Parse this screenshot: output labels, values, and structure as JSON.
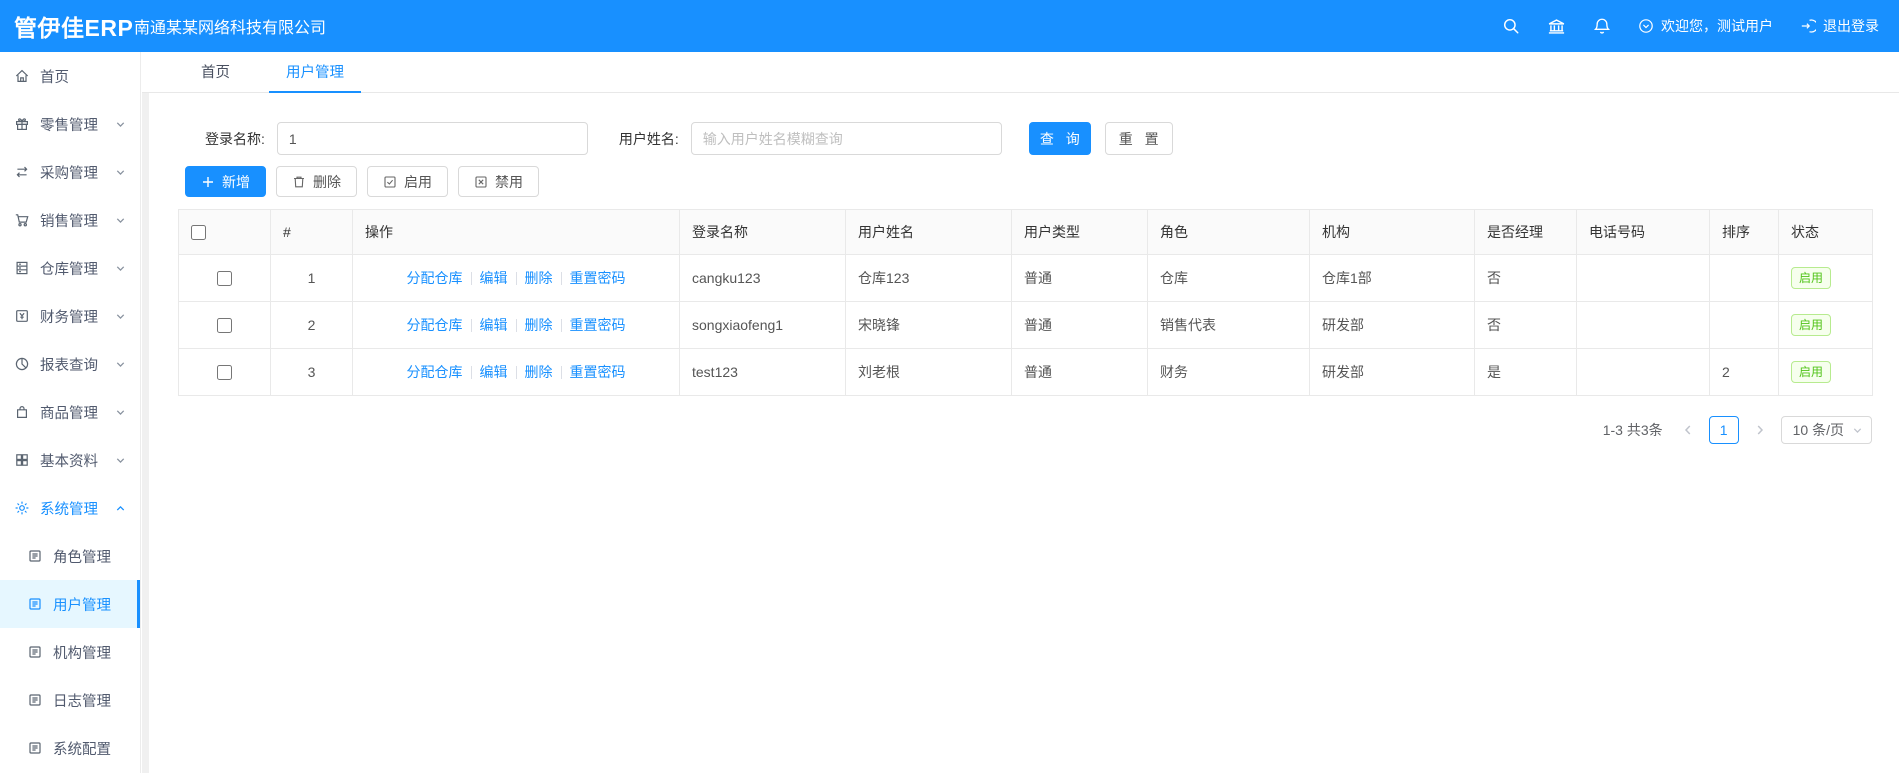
{
  "colors": {
    "primary": "#1890ff",
    "success": "#52c41a",
    "selected_menu_bg": "#e6f7ff"
  },
  "header": {
    "logo": "管伊佳ERP",
    "company": "南通某某网络科技有限公司",
    "icons": [
      "search-icon",
      "bank-icon",
      "bell-icon"
    ],
    "welcome": "欢迎您，测试用户",
    "logout": "退出登录"
  },
  "sidebar": {
    "items": [
      {
        "label": "首页",
        "icon": "home-icon"
      },
      {
        "label": "零售管理",
        "icon": "retail-icon",
        "chevron": "down"
      },
      {
        "label": "采购管理",
        "icon": "purchase-icon",
        "chevron": "down"
      },
      {
        "label": "销售管理",
        "icon": "sales-cart-icon",
        "chevron": "down"
      },
      {
        "label": "仓库管理",
        "icon": "warehouse-icon",
        "chevron": "down"
      },
      {
        "label": "财务管理",
        "icon": "finance-icon",
        "chevron": "down"
      },
      {
        "label": "报表查询",
        "icon": "report-pie-icon",
        "chevron": "down"
      },
      {
        "label": "商品管理",
        "icon": "goods-bag-icon",
        "chevron": "down"
      },
      {
        "label": "基本资料",
        "icon": "grid-icon",
        "chevron": "down"
      },
      {
        "label": "系统管理",
        "icon": "gear-icon",
        "chevron": "up",
        "active": true
      },
      {
        "label": "角色管理",
        "icon": "doc-icon",
        "sub": true
      },
      {
        "label": "用户管理",
        "icon": "doc-icon",
        "sub": true,
        "selected": true
      },
      {
        "label": "机构管理",
        "icon": "doc-icon",
        "sub": true
      },
      {
        "label": "日志管理",
        "icon": "doc-icon",
        "sub": true
      },
      {
        "label": "系统配置",
        "icon": "doc-icon",
        "sub": true
      }
    ]
  },
  "tabs": [
    {
      "label": "首页"
    },
    {
      "label": "用户管理",
      "active": true
    }
  ],
  "search": {
    "login_label": "登录名称:",
    "login_value": "1",
    "name_label": "用户姓名:",
    "name_placeholder": "输入用户姓名模糊查询",
    "query_label": "查 询",
    "reset_label": "重 置"
  },
  "toolbar": {
    "add_label": "新增",
    "delete_label": "删除",
    "enable_label": "启用",
    "disable_label": "禁用"
  },
  "table": {
    "columns": [
      "#",
      "操作",
      "登录名称",
      "用户姓名",
      "用户类型",
      "角色",
      "机构",
      "是否经理",
      "电话号码",
      "排序",
      "状态"
    ],
    "action_links": [
      "分配仓库",
      "编辑",
      "删除",
      "重置密码"
    ],
    "rows": [
      {
        "index": "1",
        "login": "cangku123",
        "name": "仓库123",
        "type": "普通",
        "role": "仓库",
        "org": "仓库1部",
        "manager": "否",
        "phone": "",
        "sort": "",
        "status": "启用"
      },
      {
        "index": "2",
        "login": "songxiaofeng1",
        "name": "宋晓锋",
        "type": "普通",
        "role": "销售代表",
        "org": "研发部",
        "manager": "否",
        "phone": "",
        "sort": "",
        "status": "启用"
      },
      {
        "index": "3",
        "login": "test123",
        "name": "刘老根",
        "type": "普通",
        "role": "财务",
        "org": "研发部",
        "manager": "是",
        "phone": "",
        "sort": "2",
        "status": "启用"
      }
    ]
  },
  "pagination": {
    "total_text": "1-3 共3条",
    "current_page": "1",
    "page_size": "10 条/页"
  }
}
